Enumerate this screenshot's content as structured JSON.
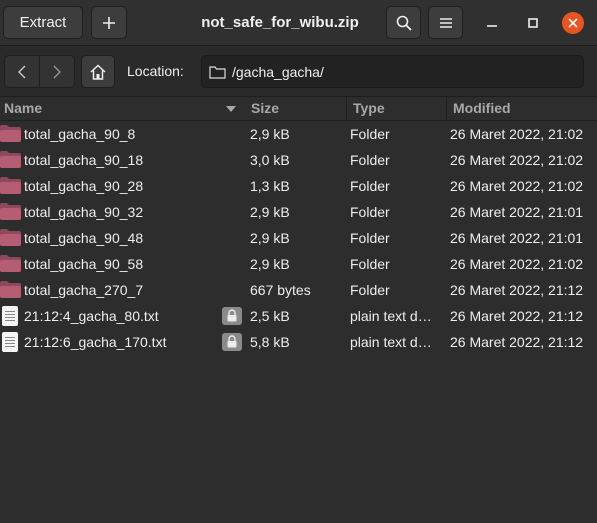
{
  "header": {
    "extract_label": "Extract",
    "add_icon": "plus-icon",
    "title": "not_safe_for_wibu.zip",
    "search_icon": "search-icon",
    "menu_icon": "hamburger-menu-icon",
    "minimize_icon": "minimize-icon",
    "maximize_icon": "maximize-icon",
    "close_icon": "close-icon",
    "close_color": "#e95420"
  },
  "location": {
    "back_icon": "chevron-left-icon",
    "forward_icon": "chevron-right-icon",
    "home_icon": "home-icon",
    "label": "Location:",
    "folder_icon": "folder-outline-icon",
    "path": "/gacha_gacha/"
  },
  "columns": {
    "name": "Name",
    "size": "Size",
    "type": "Type",
    "modified": "Modified"
  },
  "files": [
    {
      "kind": "folder",
      "name": "total_gacha_90_8",
      "size": "2,9 kB",
      "type": "Folder",
      "modified": "26 Maret 2022, 21:02",
      "locked": false
    },
    {
      "kind": "folder",
      "name": "total_gacha_90_18",
      "size": "3,0 kB",
      "type": "Folder",
      "modified": "26 Maret 2022, 21:02",
      "locked": false
    },
    {
      "kind": "folder",
      "name": "total_gacha_90_28",
      "size": "1,3 kB",
      "type": "Folder",
      "modified": "26 Maret 2022, 21:02",
      "locked": false
    },
    {
      "kind": "folder",
      "name": "total_gacha_90_32",
      "size": "2,9 kB",
      "type": "Folder",
      "modified": "26 Maret 2022, 21:01",
      "locked": false
    },
    {
      "kind": "folder",
      "name": "total_gacha_90_48",
      "size": "2,9 kB",
      "type": "Folder",
      "modified": "26 Maret 2022, 21:01",
      "locked": false
    },
    {
      "kind": "folder",
      "name": "total_gacha_90_58",
      "size": "2,9 kB",
      "type": "Folder",
      "modified": "26 Maret 2022, 21:02",
      "locked": false
    },
    {
      "kind": "folder",
      "name": "total_gacha_270_7",
      "size": "667 bytes",
      "type": "Folder",
      "modified": "26 Maret 2022, 21:12",
      "locked": false
    },
    {
      "kind": "file",
      "name": "21:12:4_gacha_80.txt",
      "size": "2,5 kB",
      "type": "plain text d…",
      "modified": "26 Maret 2022, 21:12",
      "locked": true
    },
    {
      "kind": "file",
      "name": "21:12:6_gacha_170.txt",
      "size": "5,8 kB",
      "type": "plain text d…",
      "modified": "26 Maret 2022, 21:12",
      "locked": true
    }
  ]
}
